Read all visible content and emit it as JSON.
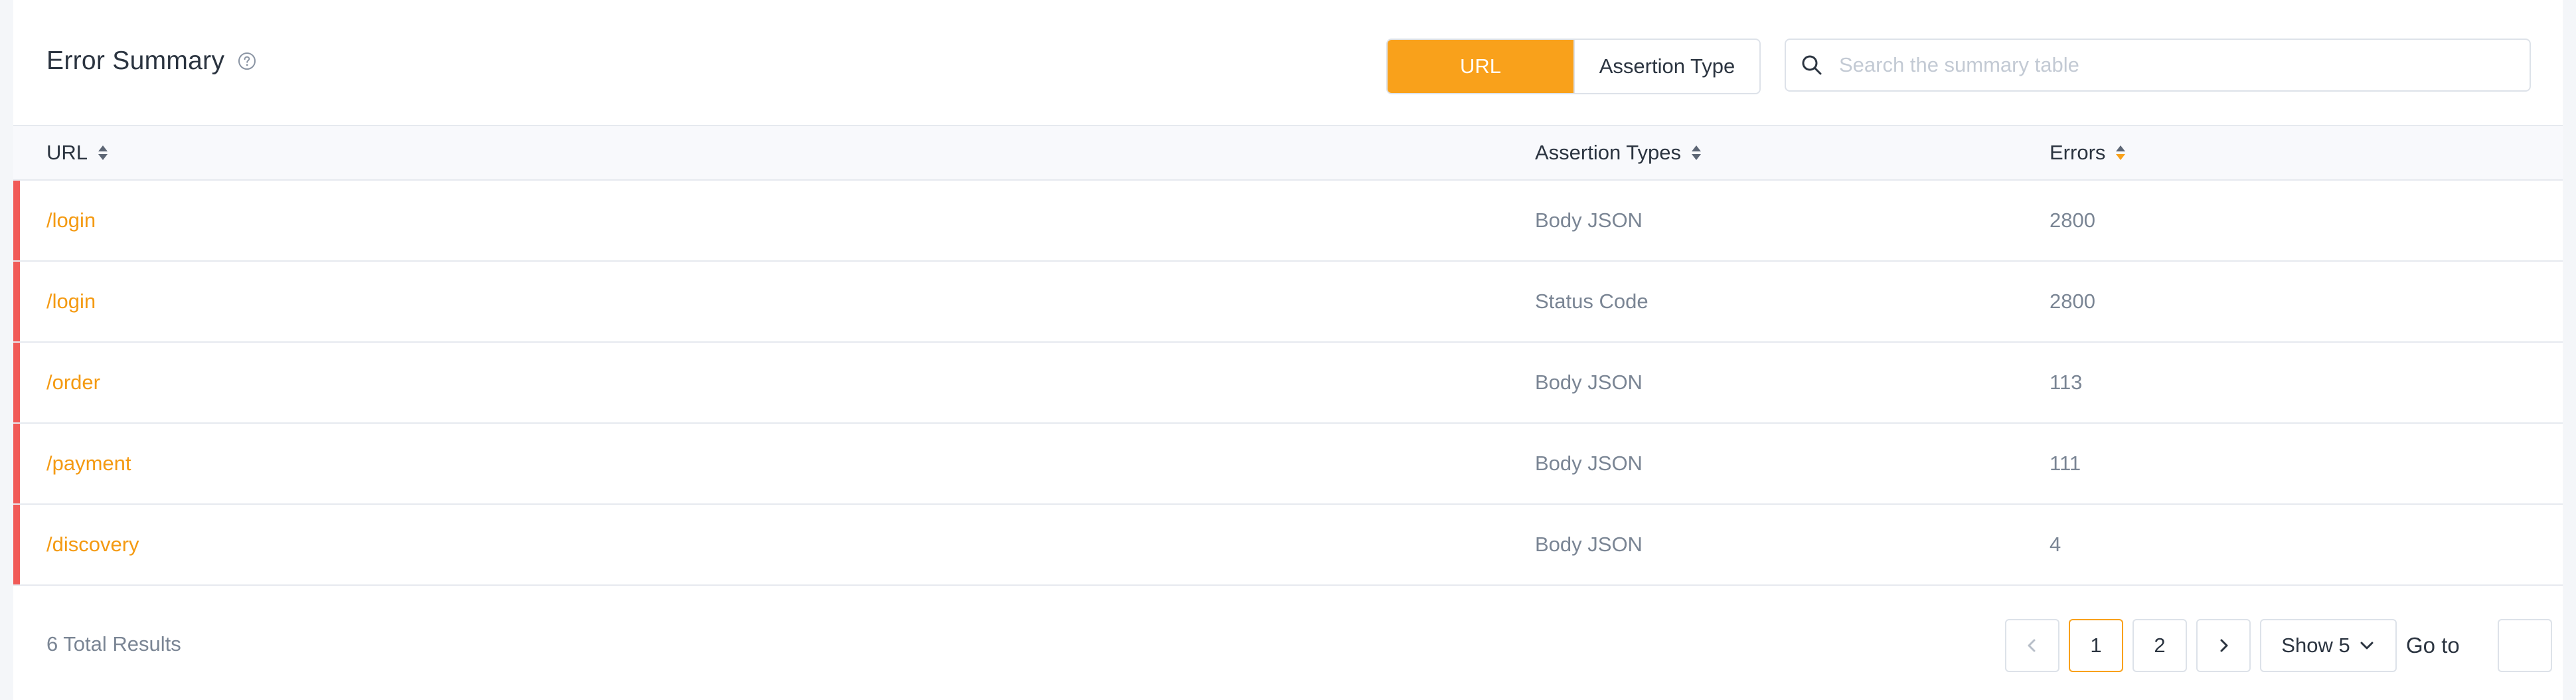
{
  "header": {
    "title": "Error Summary",
    "help_icon": "question-circle-icon",
    "group_by": {
      "options": [
        "URL",
        "Assertion Type"
      ],
      "selected": "URL"
    },
    "search": {
      "placeholder": "Search the summary table",
      "value": "",
      "icon": "search-icon"
    }
  },
  "table": {
    "columns": [
      {
        "label": "URL",
        "sort": "none"
      },
      {
        "label": "Assertion Types",
        "sort": "none"
      },
      {
        "label": "Errors",
        "sort": "descending"
      }
    ],
    "rows": [
      {
        "url": "/login",
        "assertion_type": "Body JSON",
        "errors": "2800"
      },
      {
        "url": "/login",
        "assertion_type": "Status Code",
        "errors": "2800"
      },
      {
        "url": "/order",
        "assertion_type": "Body JSON",
        "errors": "113"
      },
      {
        "url": "/payment",
        "assertion_type": "Body JSON",
        "errors": "111"
      },
      {
        "url": "/discovery",
        "assertion_type": "Body JSON",
        "errors": "4"
      }
    ]
  },
  "footer": {
    "total_results": "6 Total Results",
    "pages": [
      "1",
      "2"
    ],
    "current_page": "1",
    "page_size_label": "Show 5",
    "goto_label": "Go to",
    "goto_value": ""
  },
  "colors": {
    "accent": "#f9a11b",
    "link": "#f49a12",
    "error_flag": "#f15a57",
    "muted_text": "#7a8594"
  }
}
